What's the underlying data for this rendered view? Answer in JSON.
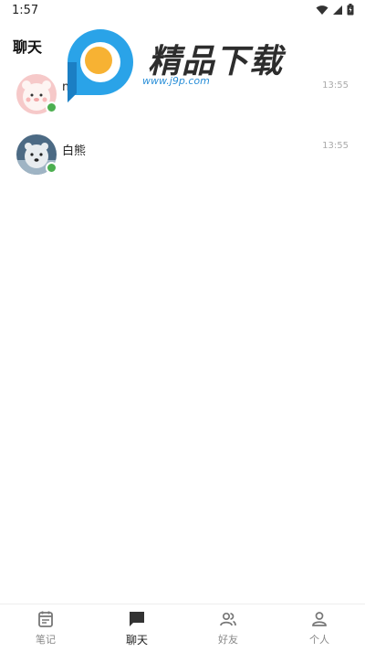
{
  "status_bar": {
    "time": "1:57"
  },
  "header": {
    "title": "聊天"
  },
  "watermark": {
    "brand": "精品下载",
    "url": "www.j9p.com"
  },
  "chats": [
    {
      "name": "momo",
      "time": "13:55",
      "online": true,
      "avatar": "pink-bear-avatar"
    },
    {
      "name": "白熊",
      "time": "13:55",
      "online": true,
      "avatar": "polar-bear-avatar"
    }
  ],
  "bottom_nav": {
    "items": [
      {
        "label": "笔记",
        "icon": "notebook-icon",
        "active": false
      },
      {
        "label": "聊天",
        "icon": "chat-bubble-icon",
        "active": true
      },
      {
        "label": "好友",
        "icon": "friends-icon",
        "active": false
      },
      {
        "label": "个人",
        "icon": "person-icon",
        "active": false
      }
    ]
  },
  "colors": {
    "online": "#4caf50",
    "accent_blue": "#2a8fd8",
    "logo_orange": "#f7b233"
  }
}
